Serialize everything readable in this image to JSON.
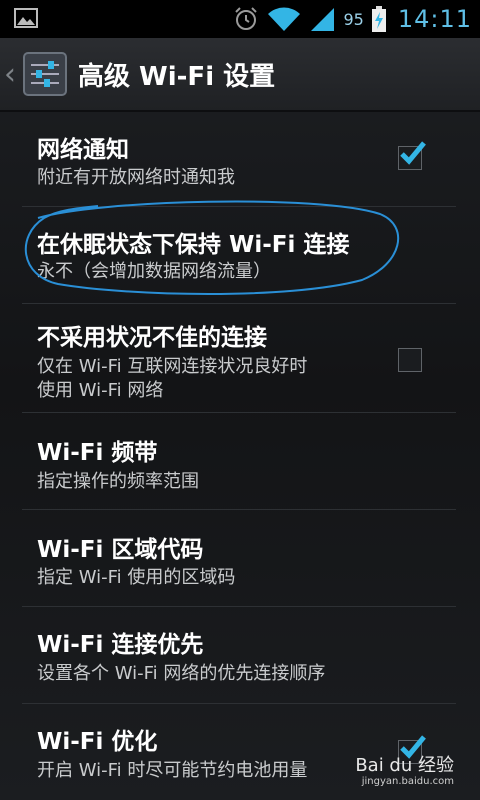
{
  "status_bar": {
    "battery_percent": "95",
    "time": "14:11",
    "icons": [
      "gallery-icon",
      "alarm-icon",
      "wifi-icon",
      "signal-icon",
      "battery-charging-icon"
    ]
  },
  "action_bar": {
    "title": "高级 Wi-Fi 设置",
    "icon": "settings-sliders-icon"
  },
  "preferences": [
    {
      "title": "网络通知",
      "summary": "附近有开放网络时通知我",
      "checkbox": true,
      "checked": true
    },
    {
      "title": "在休眠状态下保持 Wi-Fi 连接",
      "summary": "永不（会增加数据网络流量）",
      "checkbox": false
    },
    {
      "title": "不采用状况不佳的连接",
      "summary_line1": "仅在 Wi-Fi 互联网连接状况良好时",
      "summary_line2": "使用 Wi-Fi 网络",
      "checkbox": true,
      "checked": false
    },
    {
      "title": "Wi-Fi 频带",
      "summary": "指定操作的频率范围",
      "checkbox": false
    },
    {
      "title": "Wi-Fi 区域代码",
      "summary": "指定 Wi-Fi 使用的区域码",
      "checkbox": false
    },
    {
      "title": "Wi-Fi 连接优先",
      "summary": "设置各个 Wi-Fi 网络的优先连接顺序",
      "checkbox": false
    },
    {
      "title": "Wi-Fi 优化",
      "summary": "开启 Wi-Fi 时尽可能节约电池用量",
      "checkbox": true,
      "checked": true
    }
  ],
  "watermark": {
    "brand": "Bai du 经验",
    "url": "jingyan.baidu.com"
  },
  "colors": {
    "accent": "#33b5e5",
    "annotation_circle": "#2a8fd6"
  }
}
